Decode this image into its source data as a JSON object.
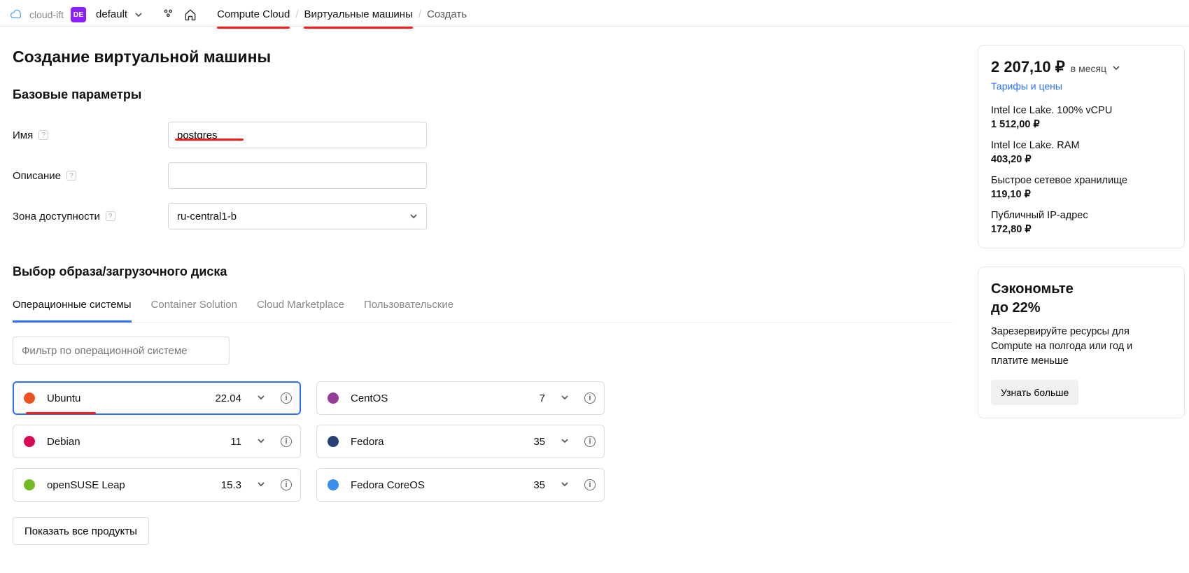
{
  "topbar": {
    "cloud_text": "cloud-ift",
    "folder_badge": "DE",
    "folder_name": "default"
  },
  "breadcrumbs": {
    "items": [
      "Compute Cloud",
      "Виртуальные машины",
      "Создать"
    ]
  },
  "page_title": "Создание виртуальной машины",
  "sections": {
    "basic": {
      "heading": "Базовые параметры",
      "fields": {
        "name": {
          "label": "Имя",
          "value": "postgres"
        },
        "description": {
          "label": "Описание",
          "value": ""
        },
        "zone": {
          "label": "Зона доступности",
          "value": "ru-central1-b"
        }
      }
    },
    "image": {
      "heading": "Выбор образа/загрузочного диска",
      "tabs": [
        "Операционные системы",
        "Container Solution",
        "Cloud Marketplace",
        "Пользовательские"
      ],
      "filter_placeholder": "Фильтр по операционной системе",
      "os": [
        {
          "name": "Ubuntu",
          "version": "22.04",
          "selected": true,
          "logo_color": "#e95420"
        },
        {
          "name": "CentOS",
          "version": "7",
          "selected": false,
          "logo_color": "#953c96"
        },
        {
          "name": "Debian",
          "version": "11",
          "selected": false,
          "logo_color": "#d70a53"
        },
        {
          "name": "Fedora",
          "version": "35",
          "selected": false,
          "logo_color": "#294172"
        },
        {
          "name": "openSUSE Leap",
          "version": "15.3",
          "selected": false,
          "logo_color": "#73ba25"
        },
        {
          "name": "Fedora CoreOS",
          "version": "35",
          "selected": false,
          "logo_color": "#3b8ded"
        }
      ],
      "show_all": "Показать все продукты"
    }
  },
  "cost": {
    "total": "2 207,10 ₽",
    "period": "в месяц",
    "tariff_link": "Тарифы и цены",
    "items": [
      {
        "label": "Intel Ice Lake. 100% vCPU",
        "amount": "1 512,00 ₽"
      },
      {
        "label": "Intel Ice Lake. RAM",
        "amount": "403,20 ₽"
      },
      {
        "label": "Быстрое сетевое хранилище",
        "amount": "119,10 ₽"
      },
      {
        "label": "Публичный IP-адрес",
        "amount": "172,80 ₽"
      }
    ]
  },
  "save": {
    "title_line1": "Сэкономьте",
    "title_line2": "до 22%",
    "body": "Зарезервируйте ресурсы для Compute на полгода или год и платите меньше",
    "button": "Узнать больше"
  }
}
